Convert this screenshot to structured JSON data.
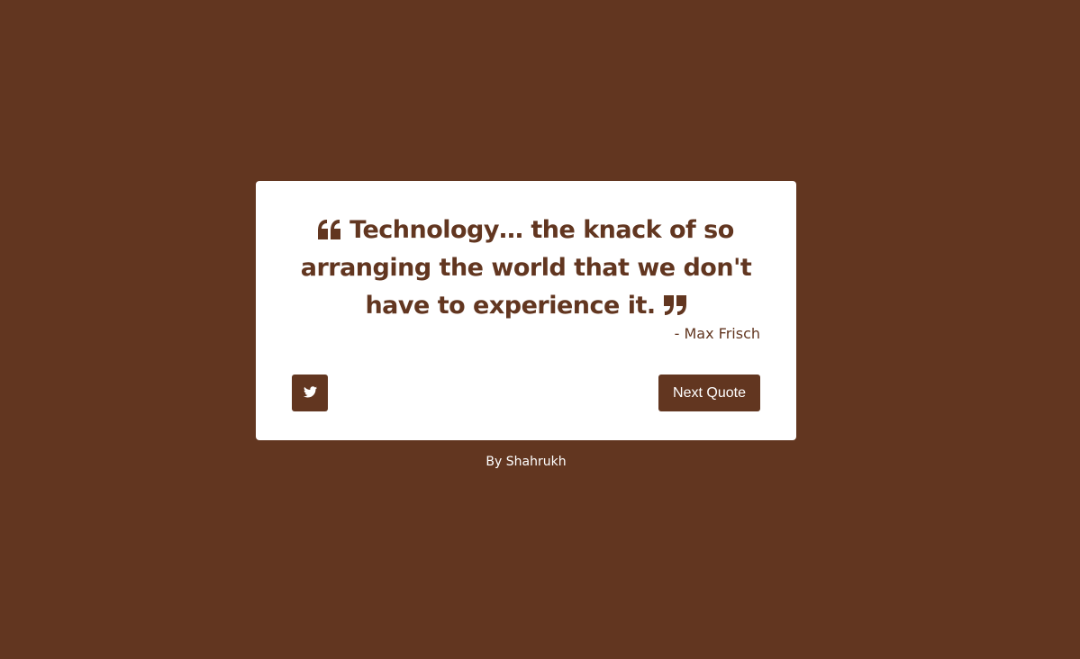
{
  "quote": {
    "text": "Technology… the knack of so arranging the world that we don't have to experience it.",
    "author": "- Max Frisch",
    "open_icon": "quote-left-icon",
    "close_icon": "quote-right-icon"
  },
  "actions": {
    "tweet_icon": "twitter-icon",
    "next_label": "Next Quote"
  },
  "footer": {
    "credit": "By Shahrukh"
  },
  "colors": {
    "background": "#623620",
    "card": "#ffffff",
    "accent": "#623620",
    "footer_text": "#ffffff"
  }
}
